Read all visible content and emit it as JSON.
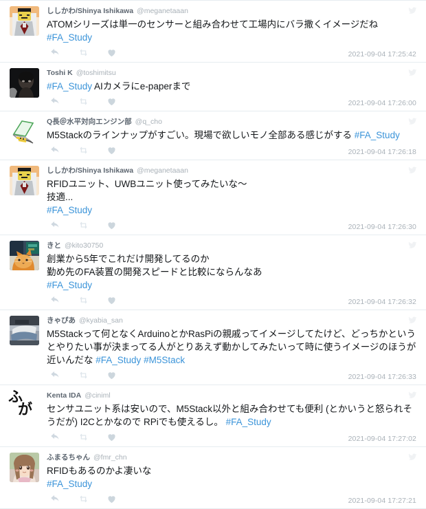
{
  "page": {
    "title": "Twitter timeline - #FA_Study",
    "accent_color": "#3b94d9",
    "divider_color": "#e6ecf0",
    "meta_color": "#a9b1b8"
  },
  "icons": {
    "reply": "reply-icon",
    "retweet": "retweet-icon",
    "like": "heart-icon",
    "brand": "twitter-bird-icon"
  },
  "tweets": [
    {
      "display_name": "ししかわ/Shinya Ishikawa",
      "handle": "@meganetaaan",
      "avatar": "lego-minifigure-avatar",
      "lines": [
        [
          {
            "t": "ATOMシリーズは単一のセンサーと組み合わせて工場内にバラ撒くイメージだね",
            "link": false
          }
        ],
        [
          {
            "t": "#FA_Study",
            "link": true
          }
        ]
      ],
      "timestamp": "2021-09-04 17:25:42"
    },
    {
      "display_name": "Toshi K",
      "handle": "@toshimitsu",
      "avatar": "dark-portrait-avatar",
      "lines": [
        [
          {
            "t": "#FA_Study",
            "link": true
          },
          {
            "t": " AIカメラにe-paperまで",
            "link": false
          }
        ]
      ],
      "timestamp": "2021-09-04 17:26:00"
    },
    {
      "display_name": "Q長＠水平対向エンジン部",
      "handle": "@q_cho",
      "avatar": "green-notebook-avatar",
      "lines": [
        [
          {
            "t": "M5Stackのラインナップがすごい。現場で欲しいモノ全部ある感じがする ",
            "link": false
          },
          {
            "t": "#FA_Study",
            "link": true
          }
        ]
      ],
      "timestamp": "2021-09-04 17:26:18"
    },
    {
      "display_name": "ししかわ/Shinya Ishikawa",
      "handle": "@meganetaaan",
      "avatar": "lego-minifigure-avatar",
      "lines": [
        [
          {
            "t": "RFIDユニット、UWBユニット使ってみたいな〜",
            "link": false
          }
        ],
        [
          {
            "t": "技適...",
            "link": false
          }
        ],
        [
          {
            "t": "#FA_Study",
            "link": true
          }
        ]
      ],
      "timestamp": "2021-09-04 17:26:30"
    },
    {
      "display_name": "きと",
      "handle": "@kito30750",
      "avatar": "orange-cat-avatar",
      "lines": [
        [
          {
            "t": "創業から5年でこれだけ開発してるのか",
            "link": false
          }
        ],
        [
          {
            "t": "勤め先のFA装置の開発スピードと比較にならんなあ",
            "link": false
          }
        ],
        [
          {
            "t": "#FA_Study",
            "link": true
          }
        ]
      ],
      "timestamp": "2021-09-04 17:26:32"
    },
    {
      "display_name": "きゃぴあ",
      "handle": "@kyabia_san",
      "avatar": "vehicle-photo-avatar",
      "lines": [
        [
          {
            "t": "M5Stackって何となくArduinoとかRasPiの親戚ってイメージしてたけど、どっちかというとやりたい事が決まってる人がとりあえず動かしてみたいって時に使うイメージのほうが近いんだな ",
            "link": false
          },
          {
            "t": "#FA_Study",
            "link": true
          },
          {
            "t": " ",
            "link": false
          },
          {
            "t": "#M5Stack",
            "link": true
          }
        ]
      ],
      "timestamp": "2021-09-04 17:26:33"
    },
    {
      "display_name": "Kenta IDA",
      "handle": "@ciniml",
      "avatar": "fuga-text-avatar",
      "avatar_text": [
        "ふ",
        "が"
      ],
      "lines": [
        [
          {
            "t": "センサユニット系は安いので、M5Stack以外と組み合わせても便利 (とかいうと怒られそうだが) I2Cとかなので RPiでも使えるし。 ",
            "link": false
          },
          {
            "t": "#FA_Study",
            "link": true
          }
        ]
      ],
      "timestamp": "2021-09-04 17:27:02"
    },
    {
      "display_name": "ふまるちゃん",
      "handle": "@fmr_chn",
      "avatar": "anime-girl-avatar",
      "lines": [
        [
          {
            "t": "RFIDもあるのかよ凄いな",
            "link": false
          }
        ],
        [
          {
            "t": "#FA_Study",
            "link": true
          }
        ]
      ],
      "timestamp": "2021-09-04 17:27:21"
    }
  ]
}
